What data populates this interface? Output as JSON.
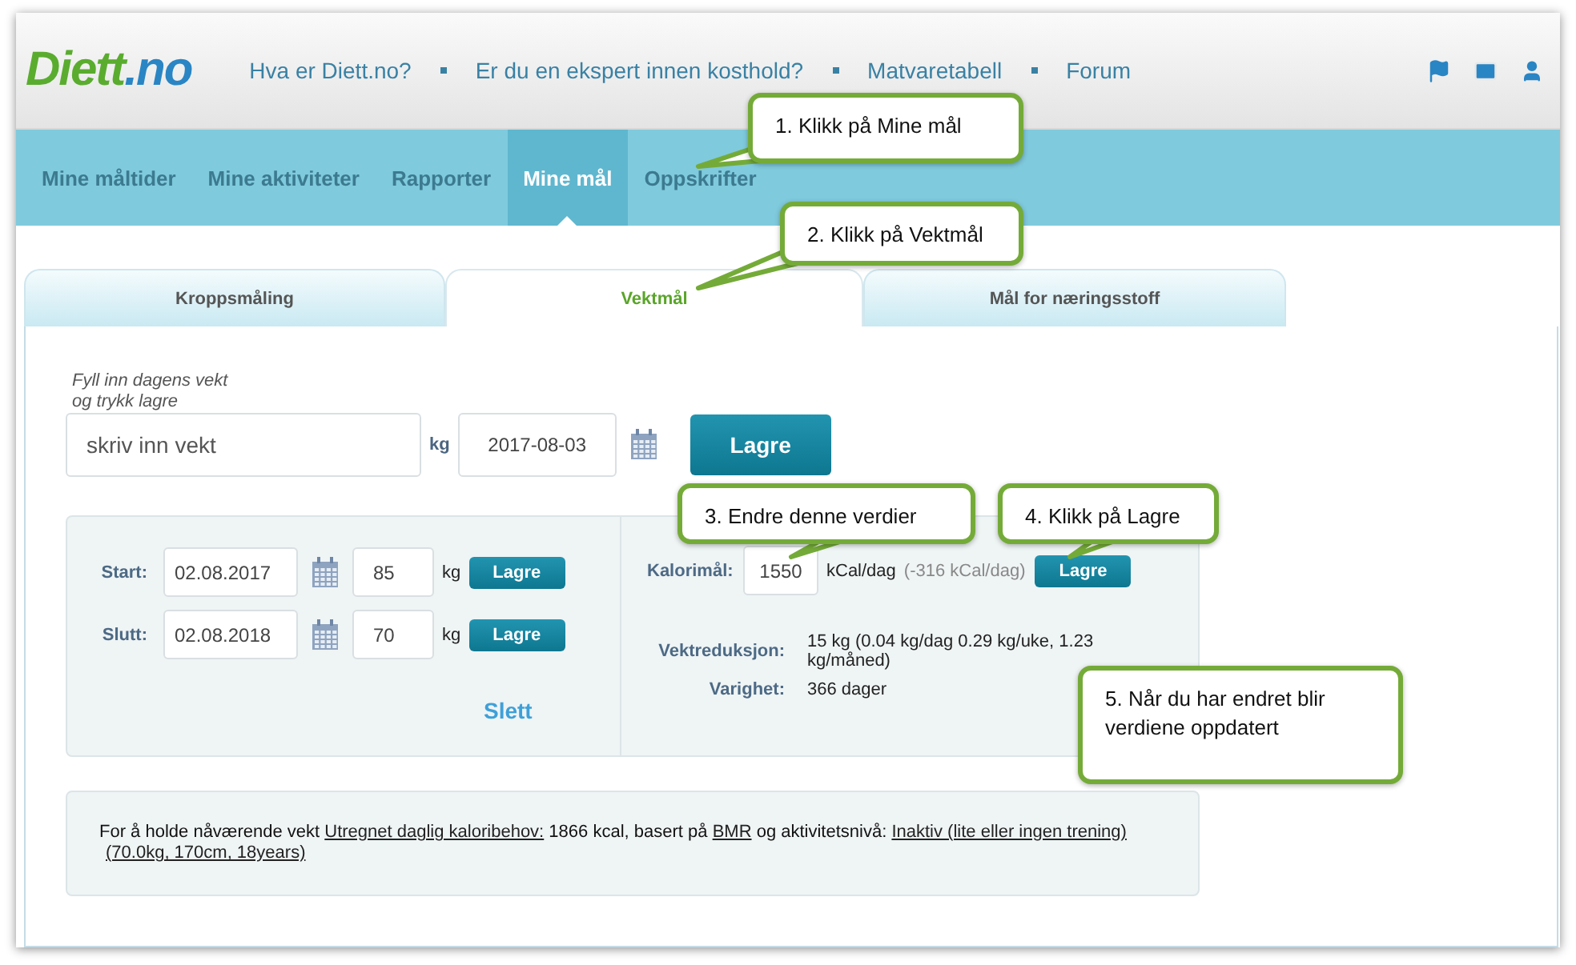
{
  "logo": {
    "name": "Diett",
    "suffix": ".no"
  },
  "top_links": [
    "Hva er Diett.no?",
    "Er du en ekspert innen kosthold?",
    "Matvaretabell",
    "Forum"
  ],
  "nav": [
    {
      "label": "Mine måltider",
      "selected": false
    },
    {
      "label": "Mine aktiviteter",
      "selected": false
    },
    {
      "label": "Rapporter",
      "selected": false
    },
    {
      "label": "Mine mål",
      "selected": true
    },
    {
      "label": "Oppskrifter",
      "selected": false
    }
  ],
  "tabs": [
    {
      "label": "Kroppsmåling",
      "selected": false
    },
    {
      "label": "Vektmål",
      "selected": true
    },
    {
      "label": "Mål for næringsstoff",
      "selected": false
    }
  ],
  "today": {
    "hint": "Fyll inn dagens vekt\nog trykk lagre",
    "placeholder": "skriv inn vekt",
    "unit": "kg",
    "date": "2017-08-03",
    "button": "Lagre"
  },
  "goals": [
    {
      "label": "Start:",
      "date": "02.08.2017",
      "weight": "85",
      "unit": "kg",
      "button": "Lagre"
    },
    {
      "label": "Slutt:",
      "date": "02.08.2018",
      "weight": "70",
      "unit": "kg",
      "button": "Lagre"
    }
  ],
  "delete": "Slett",
  "calorie": {
    "label": "Kalorimål:",
    "value": "1550",
    "unit": "kCal/dag",
    "diff": "(-316 kCal/dag)",
    "button": "Lagre"
  },
  "stats": [
    {
      "label": "Vektreduksjon:",
      "value": "15 kg (0.04 kg/dag 0.29 kg/uke, 1.23 kg/måned)"
    },
    {
      "label": "Varighet:",
      "value": "366 dager"
    }
  ],
  "info": [
    {
      "kind": "text",
      "text": "For å holde nåværende vekt "
    },
    {
      "kind": "link",
      "text": "Utregnet daglig kaloribehov:"
    },
    {
      "kind": "text",
      "text": " 1866 kcal, basert på "
    },
    {
      "kind": "link",
      "text": "BMR"
    },
    {
      "kind": "text",
      "text": " og aktivitetsnivå: "
    },
    {
      "kind": "link",
      "text": "Inaktiv (lite eller ingen trening)"
    },
    {
      "kind": "link",
      "text": "(70.0kg, 170cm, 18years)"
    }
  ],
  "callouts": [
    {
      "text": "1. Klikk på Mine mål"
    },
    {
      "text": "2. Klikk på Vektmål"
    },
    {
      "text": "3. Endre denne verdier"
    },
    {
      "text": "4. Klikk på Lagre"
    },
    {
      "text": "5. Når du har endret blir verdiene oppdatert"
    }
  ]
}
